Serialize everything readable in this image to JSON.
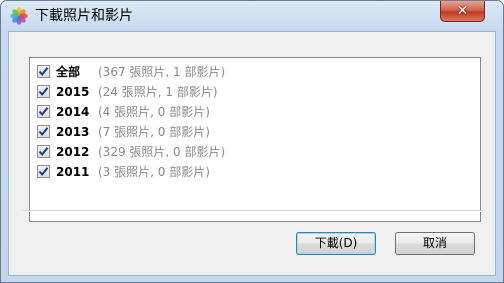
{
  "window": {
    "title": "下載照片和影片",
    "close_glyph": "✕",
    "app_icon": "photos-app-icon"
  },
  "list": {
    "items": [
      {
        "label": "全部",
        "detail": "(367 張照片, 1 部影片)",
        "checked": true
      },
      {
        "label": "2015",
        "detail": "(24 張照片, 1 部影片)",
        "checked": true
      },
      {
        "label": "2014",
        "detail": "(4 張照片, 0 部影片)",
        "checked": true
      },
      {
        "label": "2013",
        "detail": "(7 張照片, 0 部影片)",
        "checked": true
      },
      {
        "label": "2012",
        "detail": "(329 張照片, 0 部影片)",
        "checked": true
      },
      {
        "label": "2011",
        "detail": "(3 張照片, 0 部影片)",
        "checked": true
      }
    ]
  },
  "buttons": {
    "download": "下載(D)",
    "cancel": "取消"
  },
  "colors": {
    "title_bar": "#c7daf0",
    "close_button": "#c23b20",
    "check_mark": "#1c3a8a",
    "detail_text": "#8a8a8a"
  }
}
